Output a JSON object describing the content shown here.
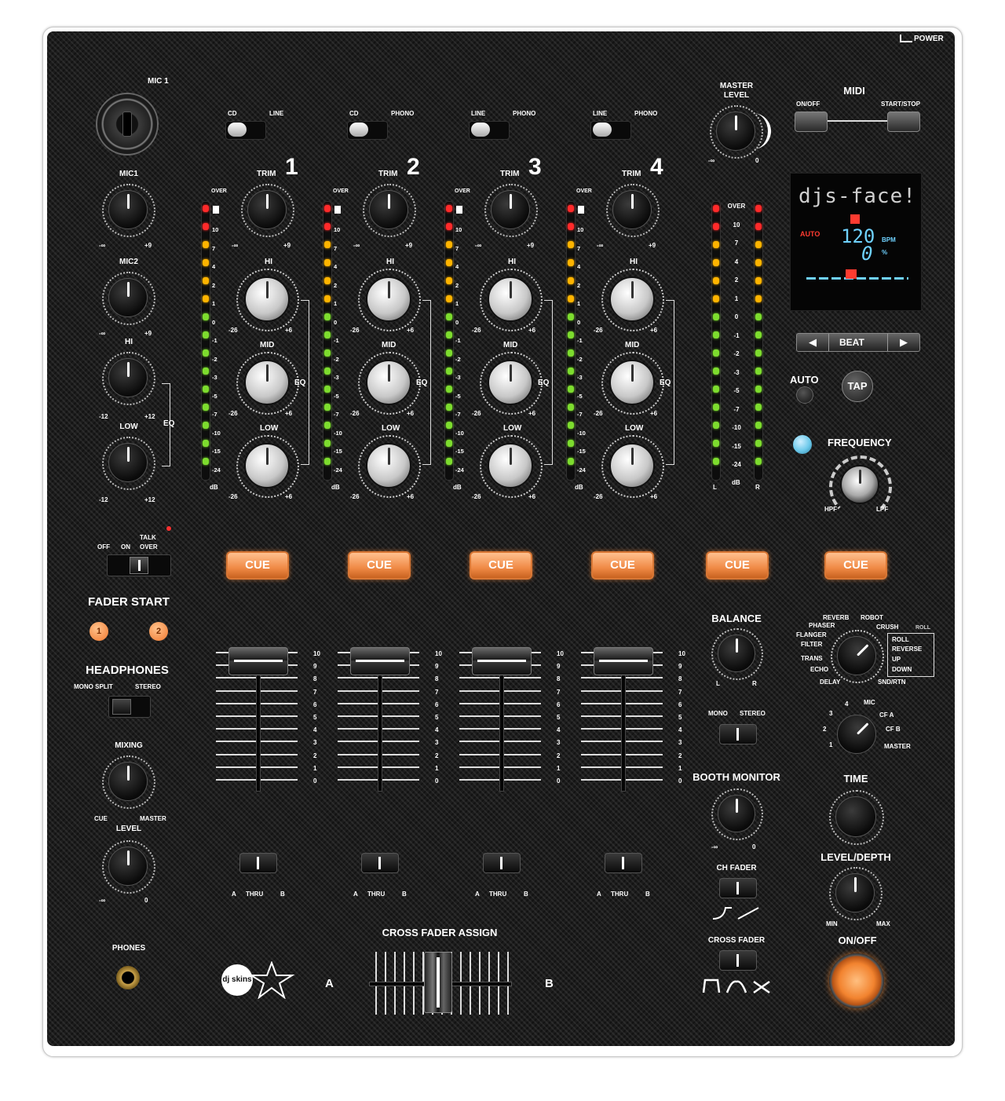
{
  "power_label": "POWER",
  "mic_input": {
    "label": "MIC 1"
  },
  "mic_section": {
    "knobs": [
      {
        "label": "MIC1",
        "min": "-∞",
        "max": "+9"
      },
      {
        "label": "MIC2",
        "min": "-∞",
        "max": "+9"
      },
      {
        "label": "HI",
        "min": "-12",
        "max": "+12"
      },
      {
        "label": "LOW",
        "min": "-12",
        "max": "+12"
      }
    ],
    "eq_label": "EQ",
    "talkover": {
      "off": "OFF",
      "on": "ON",
      "talk": "TALK",
      "over": "OVER"
    }
  },
  "channels": [
    {
      "number": "1",
      "source_left": "CD",
      "source_right": "LINE"
    },
    {
      "number": "2",
      "source_left": "CD",
      "source_right": "PHONO"
    },
    {
      "number": "3",
      "source_left": "LINE",
      "source_right": "PHONO"
    },
    {
      "number": "4",
      "source_left": "LINE",
      "source_right": "PHONO"
    }
  ],
  "channel_labels": {
    "trim": "TRIM",
    "hi": "HI",
    "mid": "MID",
    "low": "LOW",
    "eq": "EQ",
    "over": "OVER",
    "db": "dB",
    "trim_min": "-∞",
    "trim_max": "+9",
    "eq_min": "-26",
    "eq_max": "+6",
    "assign_a": "A",
    "assign_thru": "THRU",
    "assign_b": "B"
  },
  "meter_scale": [
    "10",
    "7",
    "4",
    "2",
    "1",
    "0",
    "-1",
    "-2",
    "-3",
    "-5",
    "-7",
    "-10",
    "-15",
    "-24"
  ],
  "master_meter_scale": [
    "OVER",
    "10",
    "7",
    "4",
    "2",
    "1",
    "0",
    "-1",
    "-2",
    "-3",
    "-5",
    "-7",
    "-10",
    "-15",
    "-24"
  ],
  "master_meter": {
    "left": "L",
    "db": "dB",
    "right": "R"
  },
  "fader_scale": [
    "10",
    "9",
    "8",
    "7",
    "6",
    "5",
    "4",
    "3",
    "2",
    "1",
    "0"
  ],
  "cue_label": "CUE",
  "master_level": {
    "label_1": "MASTER",
    "label_2": "LEVEL",
    "min": "-∞",
    "max": "0"
  },
  "midi": {
    "title": "MIDI",
    "on_off": "ON/OFF",
    "start_stop": "START/STOP"
  },
  "display": {
    "brand": "djs-face!",
    "mode": "AUTO",
    "bpm_value": "120",
    "bpm_unit": "BPM",
    "pct_value": "0",
    "pct_unit": "%"
  },
  "beat": {
    "label": "BEAT",
    "left": "◀",
    "right": "▶"
  },
  "auto_label": "AUTO",
  "tap_label": "TAP",
  "frequency": {
    "label": "FREQUENCY",
    "hpf": "HPF",
    "lpf": "LPF"
  },
  "fader_start": {
    "title": "FADER START",
    "btn1": "1",
    "btn2": "2"
  },
  "headphones": {
    "title": "HEADPHONES",
    "mono_split": "MONO SPLIT",
    "stereo": "STEREO",
    "mixing": "MIXING",
    "cue": "CUE",
    "master": "MASTER",
    "level": "LEVEL",
    "level_min": "-∞",
    "level_max": "0",
    "phones": "PHONES"
  },
  "balance": {
    "label": "BALANCE",
    "l": "L",
    "r": "R"
  },
  "mono_stereo": {
    "mono": "MONO",
    "stereo": "STEREO"
  },
  "booth_monitor": {
    "label": "BOOTH MONITOR",
    "min": "-∞",
    "max": "0"
  },
  "ch_fader": {
    "label": "CH FADER"
  },
  "cross_fader_curve": {
    "label": "CROSS FADER"
  },
  "effects": {
    "left": [
      "REVERB",
      "PHASER",
      "FLANGER",
      "FILTER",
      "TRANS",
      "ECHO",
      "DELAY"
    ],
    "top_right": [
      "ROBOT",
      "CRUSH"
    ],
    "roll": "ROLL",
    "box": [
      "ROLL",
      "REVERSE",
      "UP",
      "DOWN"
    ],
    "bottom_right": "SND/RTN"
  },
  "channel_select": {
    "options_left": [
      "4",
      "3",
      "2",
      "1"
    ],
    "options_right": [
      "MIC",
      "CF A",
      "CF B",
      "MASTER"
    ]
  },
  "time_label": "TIME",
  "level_depth": {
    "label": "LEVEL/DEPTH",
    "min": "MIN",
    "max": "MAX"
  },
  "fx_on_off": "ON/OFF",
  "cross_fader": {
    "assign": "CROSS FADER ASSIGN",
    "a": "A",
    "b": "B"
  },
  "logo": {
    "text": "dj skins"
  },
  "colors": {
    "cue_orange": "#f08a46",
    "led_red": "#ff2a2a",
    "led_yellow": "#ffb400",
    "led_green": "#7ddc2e",
    "freq_led": "#6cc9ea"
  }
}
